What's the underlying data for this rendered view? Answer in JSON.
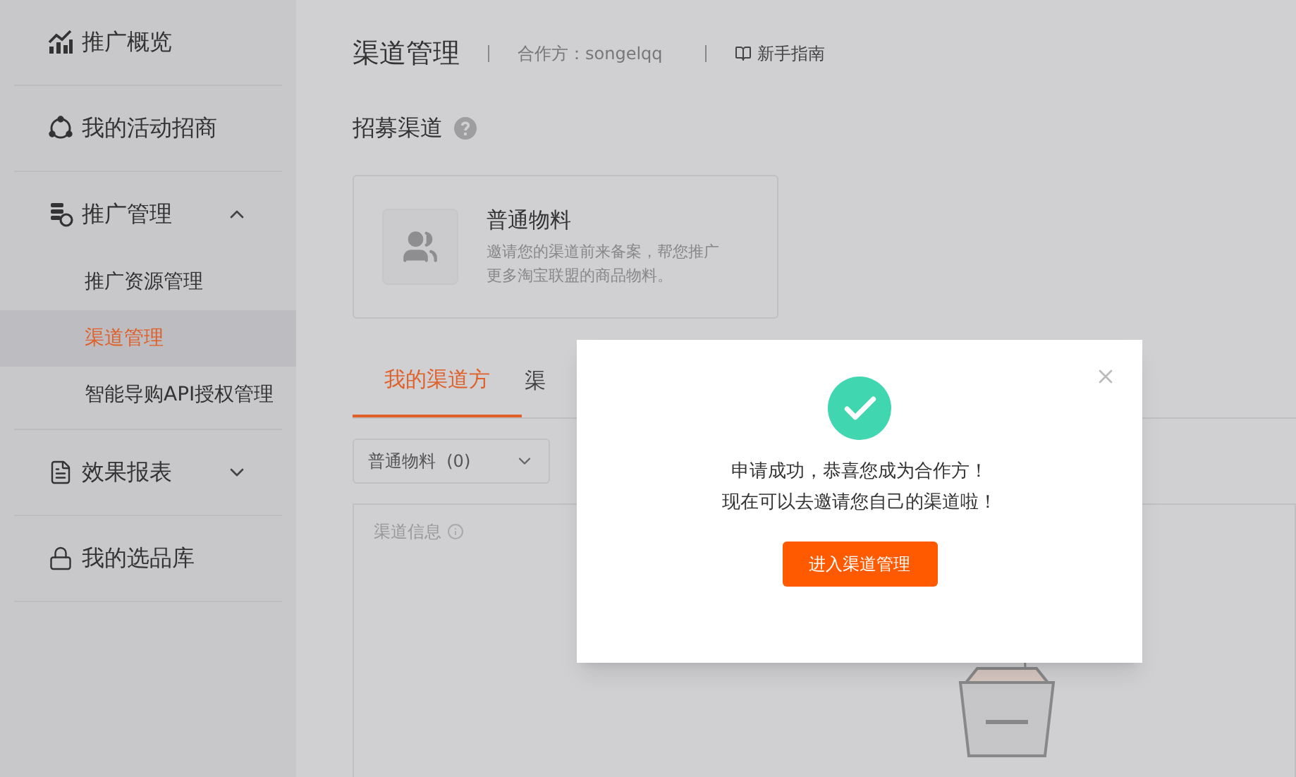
{
  "sidebar": {
    "items": [
      {
        "label": "推广概览"
      },
      {
        "label": "我的活动招商"
      },
      {
        "label": "推广管理",
        "expanded": true,
        "children": [
          {
            "label": "推广资源管理",
            "selected": false
          },
          {
            "label": "渠道管理",
            "selected": true
          },
          {
            "label": "智能导购API授权管理",
            "selected": false
          }
        ]
      },
      {
        "label": "效果报表",
        "expanded": false
      },
      {
        "label": "我的选品库"
      }
    ]
  },
  "header": {
    "title": "渠道管理",
    "partner": "合作方：songelqq",
    "guide": "新手指南"
  },
  "recruit": {
    "title": "招募渠道",
    "card": {
      "title": "普通物料",
      "description": "邀请您的渠道前来备案，帮您推广更多淘宝联盟的商品物料。"
    }
  },
  "tabs": [
    {
      "label": "我的渠道方",
      "selected": true
    },
    {
      "label": "渠",
      "selected": false
    }
  ],
  "filter": {
    "value": "普通物料  (0)"
  },
  "panel": {
    "label": "渠道信息"
  },
  "dialog": {
    "lines": [
      "申请成功，恭喜您成为合作方！",
      "现在可以去邀请您自己的渠道啦！"
    ],
    "button": "进入渠道管理"
  }
}
